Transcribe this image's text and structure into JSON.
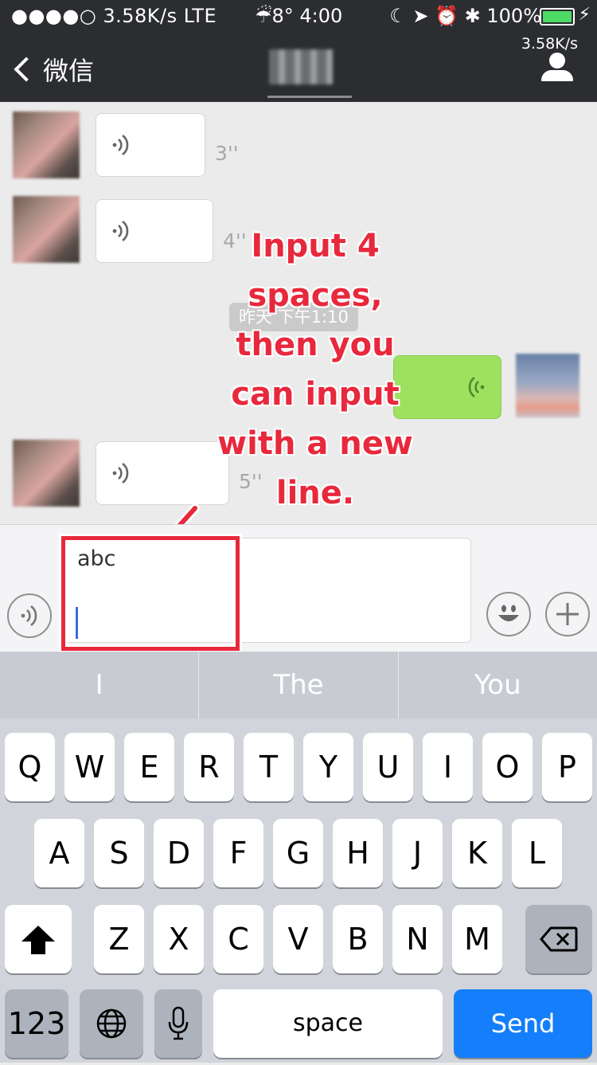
{
  "status_bar": {
    "left": "●●●●○ 3.58K/s  LTE",
    "center": "☔8° 4:00",
    "right": "☾ ➤ ⏰ ✱ 100%",
    "battery_level": 1.0,
    "net_speed": "3.58K/s"
  },
  "nav": {
    "back_label": "微信"
  },
  "messages": [
    {
      "from": "other",
      "duration": "3''"
    },
    {
      "from": "other",
      "duration": "4''"
    },
    {
      "type": "timestamp",
      "text": "昨天 下午1:10"
    },
    {
      "from": "me",
      "duration": ""
    },
    {
      "from": "other",
      "duration": "5''"
    }
  ],
  "annotation": {
    "text": "Input 4 spaces, then you can input with a new line."
  },
  "input_bar": {
    "value": "abc"
  },
  "suggestions": [
    "I",
    "The",
    "You"
  ],
  "keyboard": {
    "row1": [
      "Q",
      "W",
      "E",
      "R",
      "T",
      "Y",
      "U",
      "I",
      "O",
      "P"
    ],
    "row2": [
      "A",
      "S",
      "D",
      "F",
      "G",
      "H",
      "J",
      "K",
      "L"
    ],
    "row3": [
      "Z",
      "X",
      "C",
      "V",
      "B",
      "N",
      "M"
    ],
    "numbers_key": "123",
    "space_key": "space",
    "send_key": "Send"
  }
}
